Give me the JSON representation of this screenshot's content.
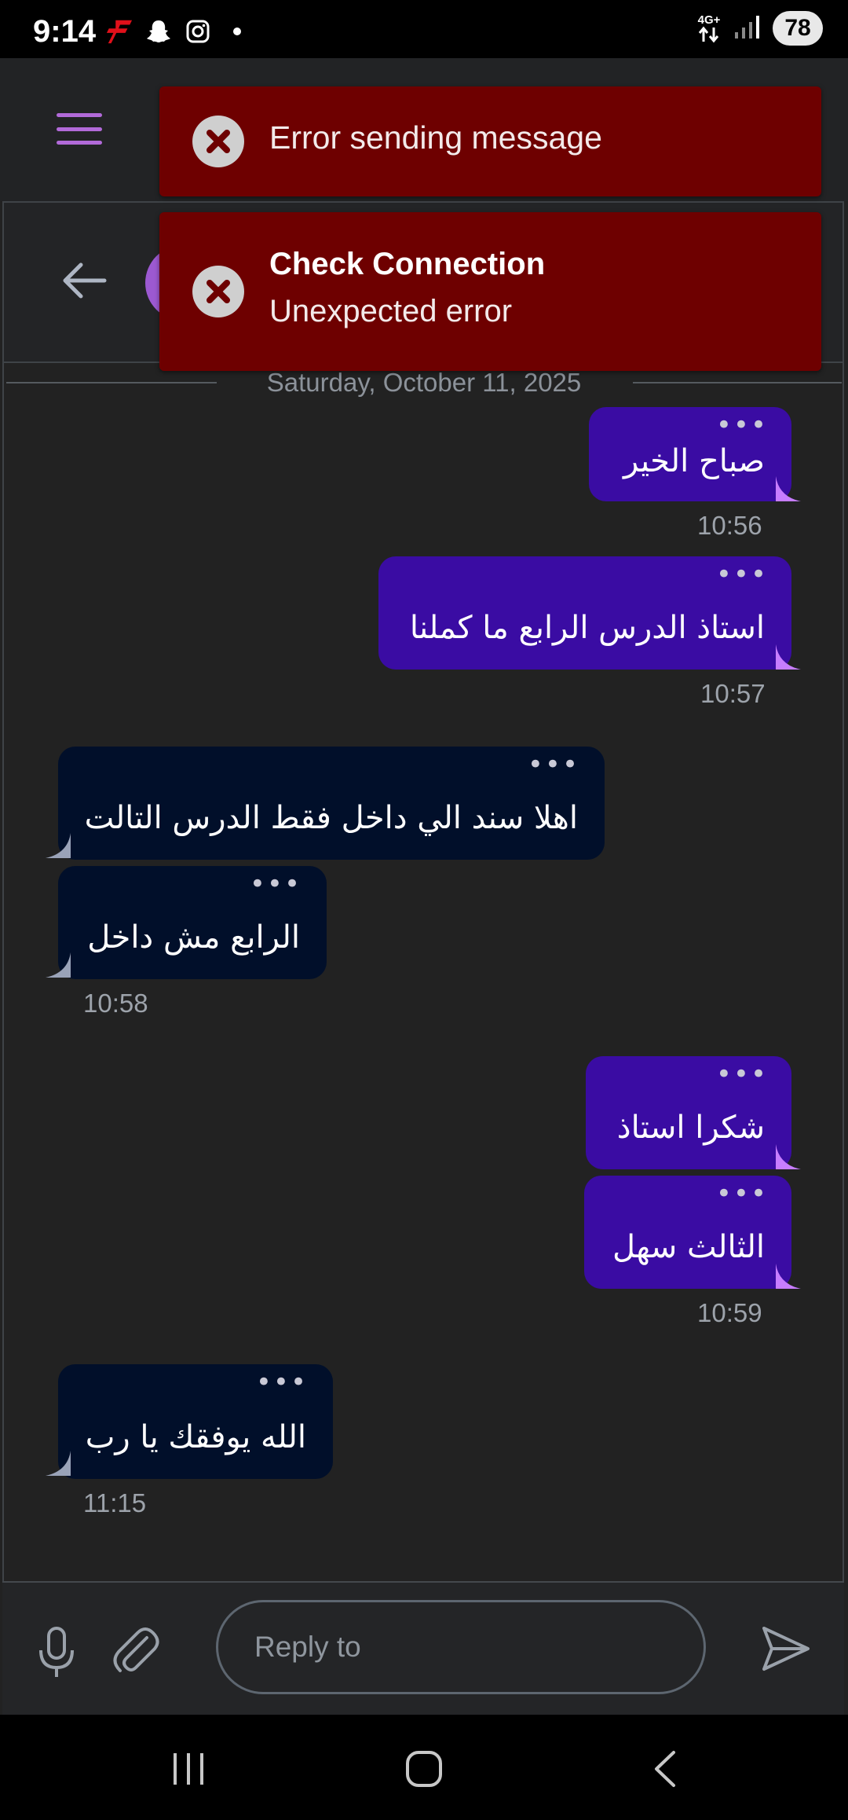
{
  "status_bar": {
    "time": "9:14",
    "network_label": "4G+",
    "battery": "78",
    "icons": [
      "flash-app-icon",
      "snapchat-icon",
      "instagram-icon",
      "notification-dot-icon",
      "data-arrows-icon",
      "signal-icon"
    ]
  },
  "toasts": [
    {
      "title": "",
      "message": "Error sending message"
    },
    {
      "title": "Check Connection",
      "message": "Unexpected error"
    }
  ],
  "chat": {
    "date_separator": "Saturday, October 11, 2025",
    "messages": [
      {
        "direction": "out",
        "text": "صباح الخير",
        "menu": "•••"
      },
      {
        "direction": "out",
        "text": "استاذ الدرس الرابع ما كملنا",
        "menu": "•••"
      },
      {
        "direction": "in",
        "text": "اهلا سند الي داخل فقط الدرس التالت",
        "menu": "•••"
      },
      {
        "direction": "in",
        "text": "الرابع مش داخل",
        "menu": "•••"
      },
      {
        "direction": "out",
        "text": "شكرا استاذ",
        "menu": "•••"
      },
      {
        "direction": "out",
        "text": "الثالث سهل",
        "menu": "•••"
      },
      {
        "direction": "in",
        "text": "الله يوفقك يا رب",
        "menu": "•••"
      }
    ],
    "times": [
      "10:56",
      "10:57",
      "10:58",
      "10:59",
      "11:15"
    ]
  },
  "composer": {
    "placeholder": "Reply to",
    "value": ""
  },
  "colors": {
    "outgoing_bubble": "#3a0ca3",
    "incoming_bubble": "#010f2a",
    "outgoing_tail": "#c77dff",
    "incoming_tail": "#9aa3b8",
    "toast_background": "#6e0000",
    "menu_accent": "#b26ad9"
  }
}
